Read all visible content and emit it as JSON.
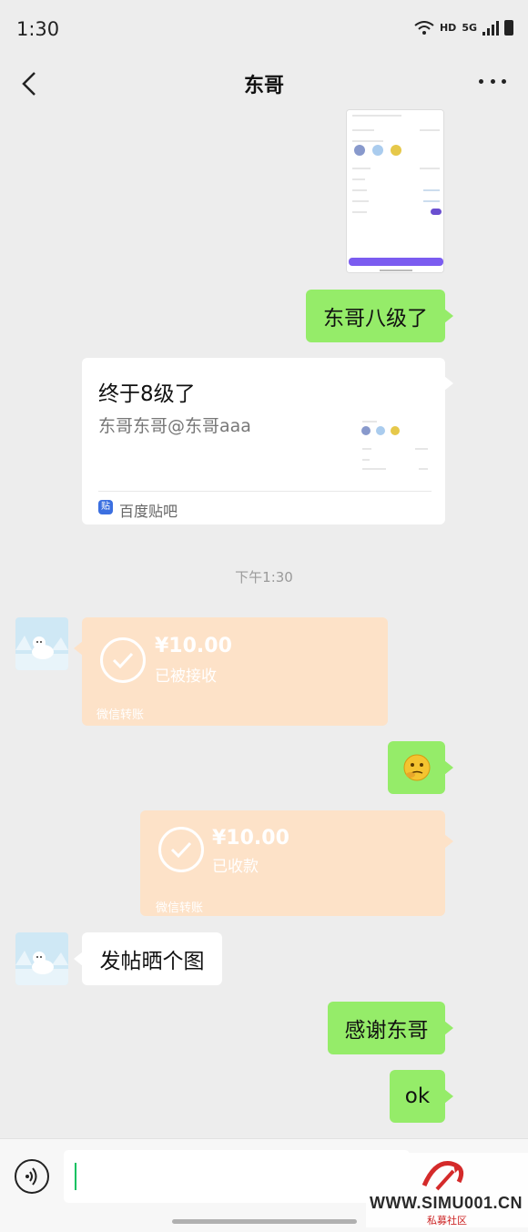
{
  "status_bar": {
    "time": "1:30",
    "hd": "HD",
    "network": "5G"
  },
  "nav": {
    "title": "东哥"
  },
  "messages": {
    "msg1": "东哥八级了",
    "card": {
      "title": "终于8级了",
      "subtitle": "东哥东哥@东哥aaa",
      "source": "百度贴吧",
      "source_icon": "贴"
    },
    "timestamp": "下午1:30",
    "transfer_in": {
      "amount": "¥10.00",
      "status": "已被接收",
      "footer": "微信转账"
    },
    "transfer_out": {
      "amount": "¥10.00",
      "status": "已收款",
      "footer": "微信转账"
    },
    "msg_recv": "发帖晒个图",
    "msg2": "感谢东哥",
    "msg3": "ok"
  },
  "input": {
    "value": "",
    "placeholder": ""
  },
  "watermark": {
    "url": "WWW.SIMU001.CN",
    "subtitle": "私募社区"
  },
  "colors": {
    "green_bubble": "#95ec69",
    "transfer_bg": "#fde2c8",
    "background": "#ededed"
  }
}
